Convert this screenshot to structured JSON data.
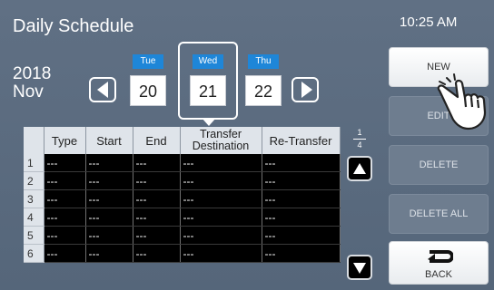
{
  "header": {
    "title": "Daily Schedule",
    "clock": "10:25 AM"
  },
  "date_nav": {
    "year": "2018",
    "month": "Nov",
    "days": [
      {
        "weekday": "Tue",
        "date": "20"
      },
      {
        "weekday": "Wed",
        "date": "21",
        "selected": true
      },
      {
        "weekday": "Thu",
        "date": "22"
      }
    ]
  },
  "table": {
    "headers": [
      "",
      "Type",
      "Start",
      "End",
      "Transfer Destination",
      "Re-Transfer"
    ],
    "rows": [
      {
        "num": "1",
        "cells": [
          "---",
          "---",
          "---",
          "---",
          "---"
        ]
      },
      {
        "num": "2",
        "cells": [
          "---",
          "---",
          "---",
          "---",
          "---"
        ]
      },
      {
        "num": "3",
        "cells": [
          "---",
          "---",
          "---",
          "---",
          "---"
        ]
      },
      {
        "num": "4",
        "cells": [
          "---",
          "---",
          "---",
          "---",
          "---"
        ]
      },
      {
        "num": "5",
        "cells": [
          "---",
          "---",
          "---",
          "---",
          "---"
        ]
      },
      {
        "num": "6",
        "cells": [
          "---",
          "---",
          "---",
          "---",
          "---"
        ]
      }
    ]
  },
  "pagination": {
    "current": "1",
    "total": "4"
  },
  "buttons": {
    "new": "NEW",
    "edit": "EDIT",
    "delete": "DELETE",
    "delete_all": "DELETE ALL",
    "back": "BACK"
  },
  "colors": {
    "background": "#5d6e82",
    "day_label": "#1e86d8",
    "table_body": "#000000"
  }
}
